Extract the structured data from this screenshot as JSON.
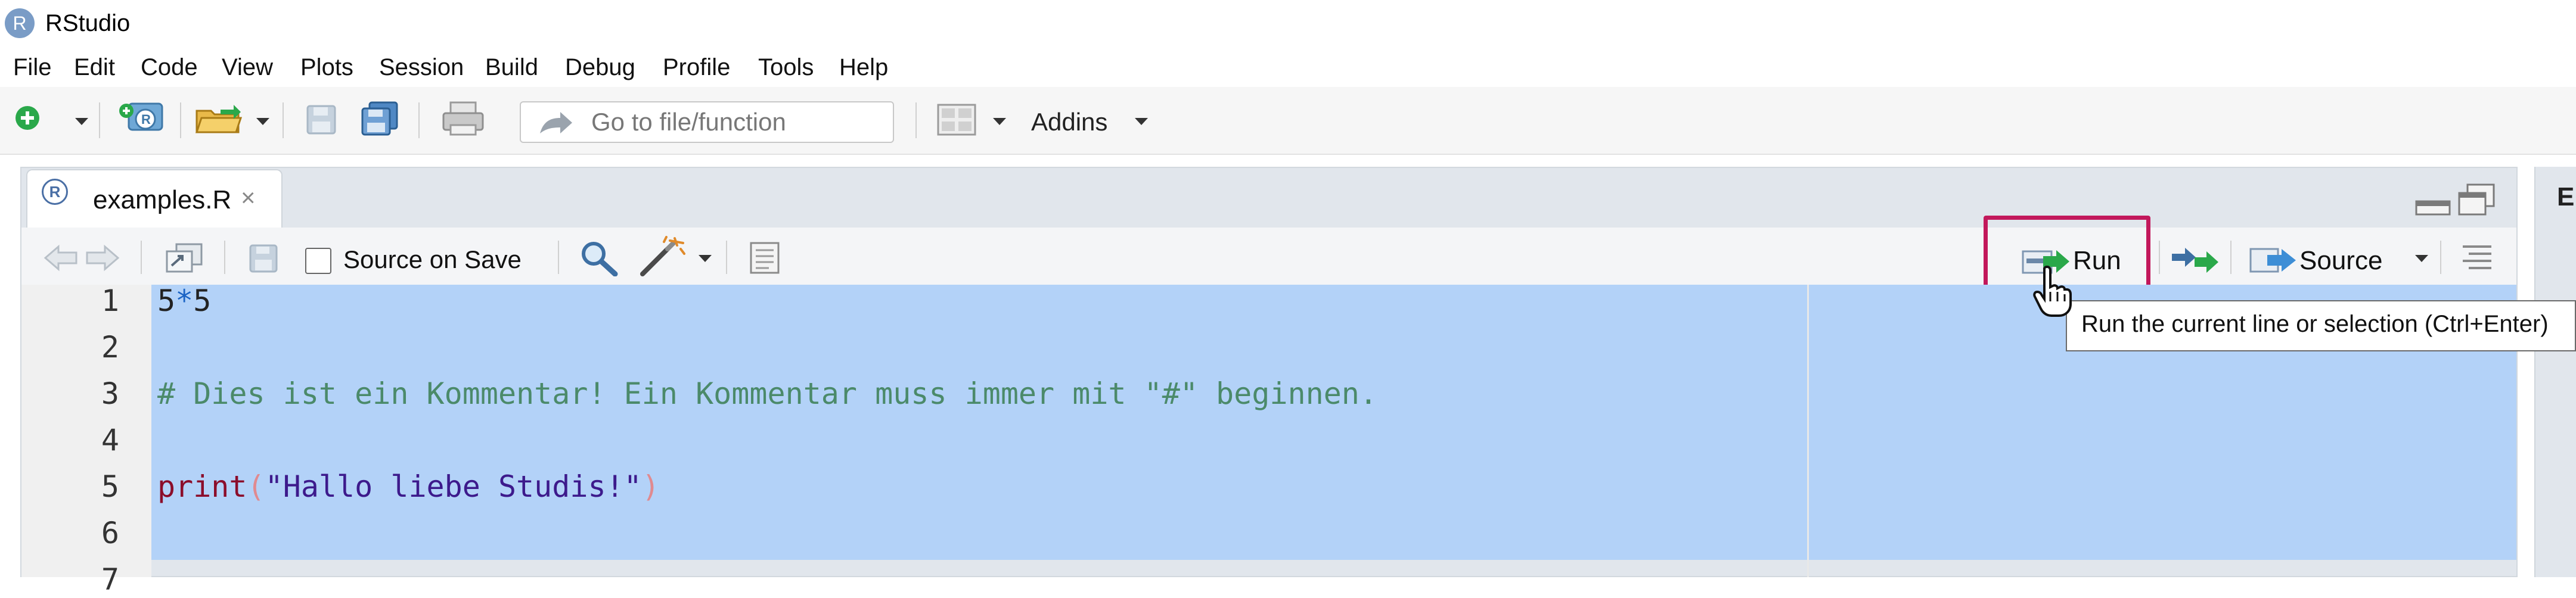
{
  "app": {
    "title": "RStudio",
    "logo_letter": "R"
  },
  "menu": [
    "File",
    "Edit",
    "Code",
    "View",
    "Plots",
    "Session",
    "Build",
    "Debug",
    "Profile",
    "Tools",
    "Help"
  ],
  "toolbar": {
    "goto_placeholder": "Go to file/function",
    "addins_label": "Addins"
  },
  "editor": {
    "tab": {
      "label": "examples.R",
      "close": "×",
      "icon_letter": "R"
    },
    "source_on_save_label": "Source on Save",
    "run_label": "Run",
    "source_label": "Source",
    "tooltip": "Run the current line or selection (Ctrl+Enter)",
    "lines": [
      {
        "num": "1",
        "parts": [
          {
            "t": "5",
            "c": "#222222"
          },
          {
            "t": "*",
            "c": "#1a63c4"
          },
          {
            "t": "5",
            "c": "#222222"
          }
        ]
      },
      {
        "num": "2",
        "parts": []
      },
      {
        "num": "3",
        "parts": [
          {
            "t": "# Dies ist ein Kommentar! Ein Kommentar muss immer mit \"#\" beginnen.",
            "c": "#4b8a6a"
          }
        ]
      },
      {
        "num": "4",
        "parts": []
      },
      {
        "num": "5",
        "parts": [
          {
            "t": "print",
            "c": "#8b0d2b"
          },
          {
            "t": "(",
            "c": "#e08a90"
          },
          {
            "t": "\"Hallo liebe Studis!\"",
            "c": "#3d1a8c"
          },
          {
            "t": ")",
            "c": "#e08a90"
          }
        ]
      },
      {
        "num": "6",
        "parts": []
      },
      {
        "num": "7",
        "parts": []
      }
    ]
  },
  "right_pane": {
    "letter": "E"
  },
  "colors": {
    "selection": "#b3d2f8",
    "highlight_box": "#c2185b",
    "accent_green": "#2aa84a"
  }
}
